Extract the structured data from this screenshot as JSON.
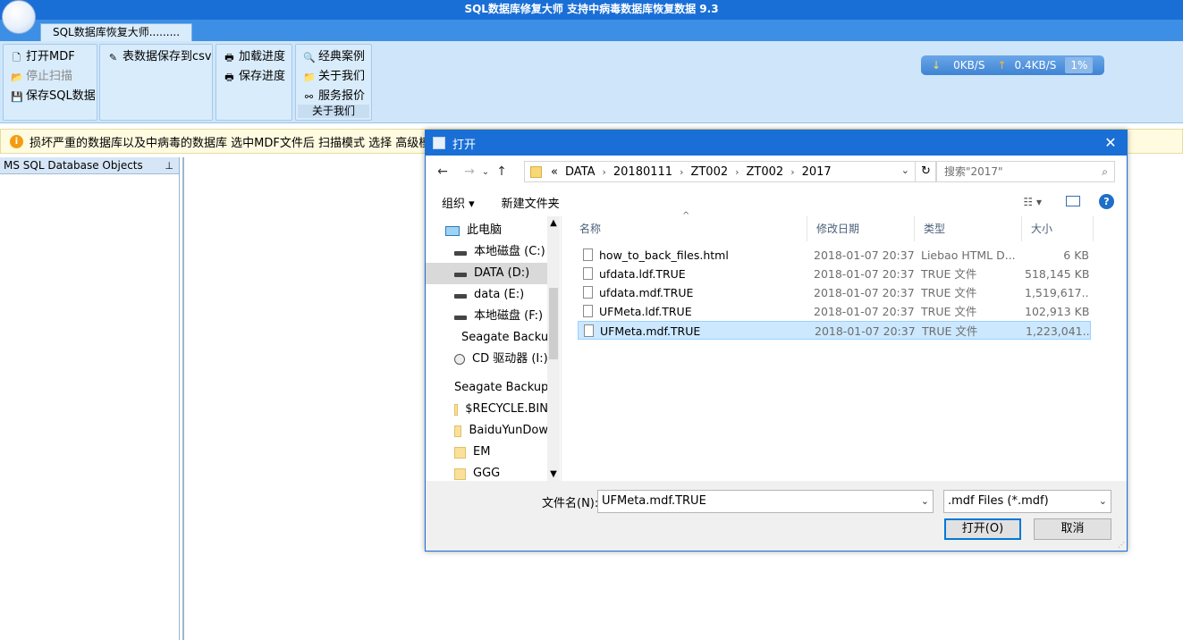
{
  "app": {
    "title": "SQL数据库修复大师 支持中病毒数据库恢复数据 9.3",
    "tab_label": "SQL数据库恢复大师.........",
    "ribbon": {
      "group1": [
        "打开MDF",
        "停止扫描",
        "保存SQL数据"
      ],
      "group2": [
        "表数据保存到csv"
      ],
      "group3": [
        "加载进度",
        "保存进度"
      ],
      "group4": [
        "经典案例",
        "关于我们",
        "服务报价"
      ],
      "group4_caption": "关于我们"
    },
    "speed": {
      "down": "0KB/S",
      "up": "0.4KB/S",
      "percent": "1%"
    },
    "info_text": "损坏严重的数据库以及中病毒的数据库 选中MDF文件后 扫描模式 选择 高级模式",
    "left_panel_title": "MS SQL Database Objects"
  },
  "dialog": {
    "title": "打开",
    "breadcrumb": [
      "«",
      "DATA",
      "20180111",
      "ZT002",
      "ZT002",
      "2017"
    ],
    "search_placeholder": "搜索\"2017\"",
    "cmd_organize": "组织 ▾",
    "cmd_new_folder": "新建文件夹",
    "tree": [
      {
        "label": "此电脑",
        "icon": "pc-icon"
      },
      {
        "label": "本地磁盘 (C:)",
        "icon": "drive-icon"
      },
      {
        "label": "DATA (D:)",
        "icon": "drive-icon",
        "selected": true
      },
      {
        "label": "data (E:)",
        "icon": "drive-icon"
      },
      {
        "label": "本地磁盘 (F:)",
        "icon": "drive-icon"
      },
      {
        "label": "Seagate Backup",
        "icon": "drive-icon"
      },
      {
        "label": "CD 驱动器 (I:)",
        "icon": "cd-icon"
      },
      {
        "label": "Seagate Backup",
        "icon": "drive-icon"
      },
      {
        "label": "$RECYCLE.BIN",
        "icon": "folder-icon"
      },
      {
        "label": "BaiduYunDow",
        "icon": "folder-icon"
      },
      {
        "label": "EM",
        "icon": "folder-icon"
      },
      {
        "label": "GGG",
        "icon": "folder-icon"
      }
    ],
    "columns": [
      "名称",
      "修改日期",
      "类型",
      "大小"
    ],
    "files": [
      {
        "name": "how_to_back_files.html",
        "date": "2018-01-07 20:37",
        "type": "Liebao HTML D...",
        "size": "6 KB"
      },
      {
        "name": "ufdata.ldf.TRUE",
        "date": "2018-01-07 20:37",
        "type": "TRUE 文件",
        "size": "518,145 KB"
      },
      {
        "name": "ufdata.mdf.TRUE",
        "date": "2018-01-07 20:37",
        "type": "TRUE 文件",
        "size": "1,519,617..."
      },
      {
        "name": "UFMeta.ldf.TRUE",
        "date": "2018-01-07 20:37",
        "type": "TRUE 文件",
        "size": "102,913 KB"
      },
      {
        "name": "UFMeta.mdf.TRUE",
        "date": "2018-01-07 20:37",
        "type": "TRUE 文件",
        "size": "1,223,041...",
        "selected": true
      }
    ],
    "filename_label": "文件名(N):",
    "filename_value": "UFMeta.mdf.TRUE",
    "filter_value": ".mdf Files (*.mdf)",
    "open_label": "打开(O)",
    "cancel_label": "取消"
  }
}
